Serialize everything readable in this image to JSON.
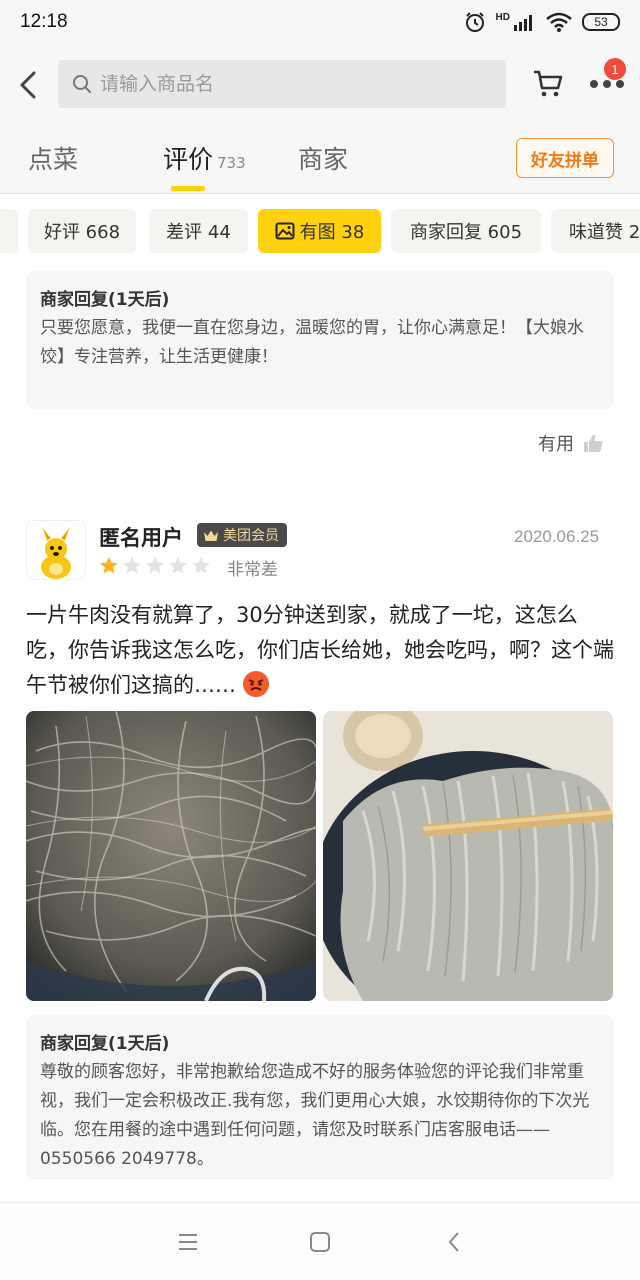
{
  "status_bar": {
    "time": "12:18",
    "network_label": "HD",
    "battery": "53",
    "icons": [
      "alarm-icon",
      "signal-icon",
      "wifi-icon",
      "battery-icon"
    ]
  },
  "top_nav": {
    "search_placeholder": "请输入商品名",
    "cart_icon": "cart-icon",
    "more_icon": "more-dots-icon",
    "badge_count": "1"
  },
  "tabs": {
    "items": [
      {
        "label": "点菜"
      },
      {
        "label": "评价",
        "count": "733"
      },
      {
        "label": "商家"
      }
    ],
    "active_index": 1,
    "group_order_label": "好友拼单"
  },
  "filters": {
    "items": [
      {
        "label": "好评 668"
      },
      {
        "label": "差评 44"
      },
      {
        "label": "有图 38",
        "active": true
      },
      {
        "label": "商家回复 605"
      },
      {
        "label": "味道赞 2"
      }
    ],
    "active_color": "#ffd10f"
  },
  "first_reply": {
    "title": "商家回复(1天后)",
    "text": "只要您愿意，我便一直在您身边，温暖您的胃，让你心满意足！【大娘水饺】专注营养，让生活更健康！"
  },
  "useful": {
    "label": "有用"
  },
  "review": {
    "username": "匿名用户",
    "member_label": "美团会员",
    "date": "2020.06.25",
    "rating": 1,
    "rating_max": 5,
    "rating_text": "非常差",
    "text": "一片牛肉没有就算了，30分钟送到家，就成了一坨，这怎么吃，你告诉我这怎么吃，你们店长给她，她会吃吗，啊？这个端午节被你们这搞的……",
    "emoji": "angry-face-icon",
    "photos": [
      "noodles-in-bowl-photo",
      "noodles-with-chopstick-photo"
    ]
  },
  "second_reply": {
    "title": "商家回复(1天后)",
    "text": "尊敬的顾客您好，非常抱歉给您造成不好的服务体验您的评论我们非常重视，我们一定会积极改正.我有您，我们更用心大娘，水饺期待你的下次光临。您在用餐的途中遇到任何问题，请您及时联系门店客服电话——0550566 2049778。"
  },
  "bottom_nav": {
    "icons": [
      "menu-icon",
      "home-icon",
      "back-icon"
    ]
  },
  "colors": {
    "accent_yellow": "#ffd100",
    "group_order_orange": "#f07a14",
    "star_gold": "#f8b51c",
    "badge_red": "#f24b3c"
  }
}
